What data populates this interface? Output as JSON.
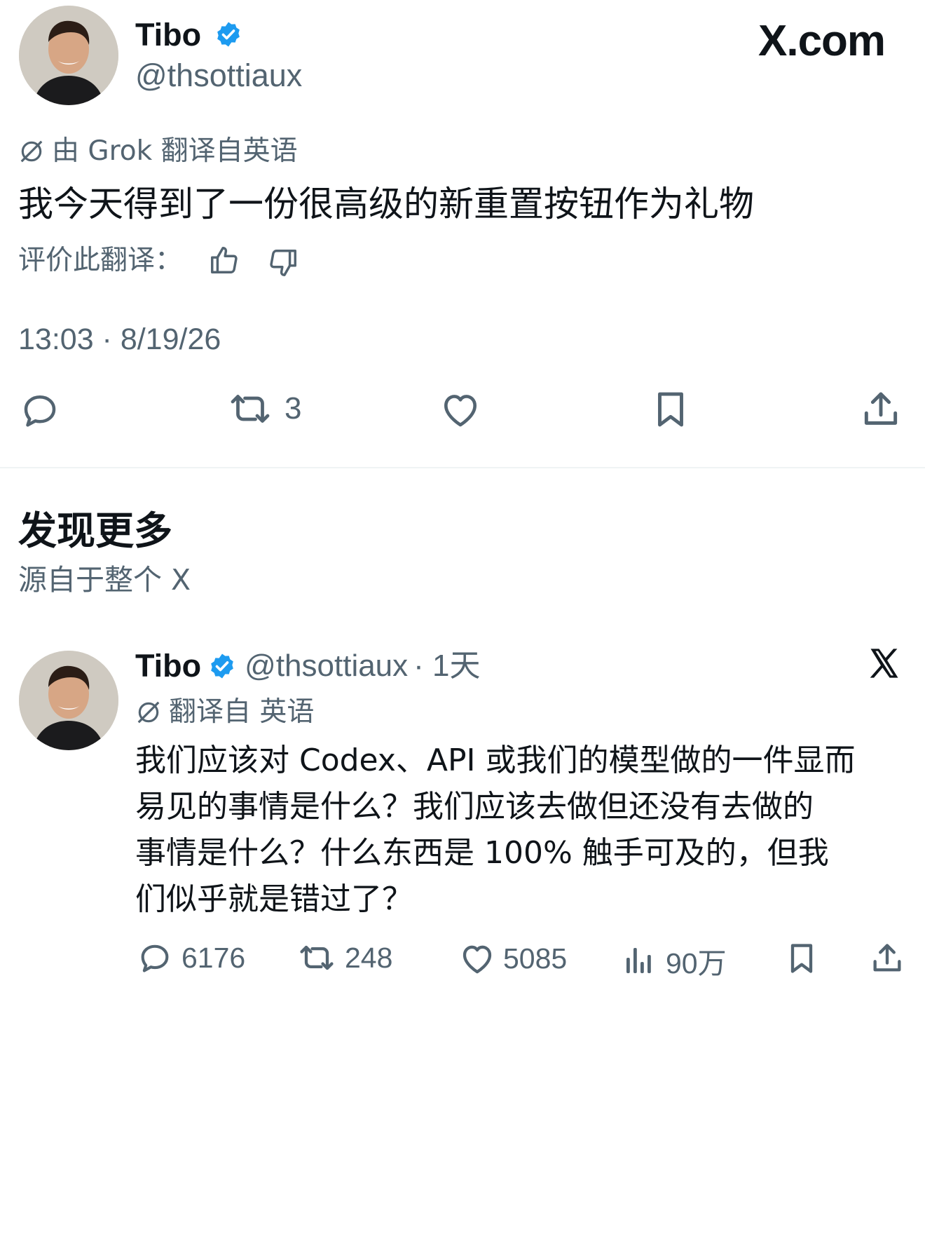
{
  "brand": {
    "logo_text": "X.com"
  },
  "main_tweet": {
    "author_name": "Tibo",
    "author_handle": "@thsottiaux",
    "translated_label": "由 Grok 翻译自英语",
    "text": "我今天得到了一份很高级的新重置按钮作为礼物",
    "rate_label": "评价此翻译：",
    "timestamp": "13:03 · 8/19/26",
    "actions": {
      "reply_icon": "reply-icon",
      "retweet_count": "3",
      "like_icon": "heart-icon",
      "bookmark_icon": "bookmark-icon",
      "share_icon": "share-icon"
    }
  },
  "discover": {
    "title": "发现更多",
    "subtitle": "源自于整个 X"
  },
  "related_tweet": {
    "author_name": "Tibo",
    "author_handle": "@thsottiaux",
    "time": "· 1天",
    "translated_label": "翻译自 英语",
    "text_lines": [
      "我们应该对 Codex、API 或我们的模型做的一件显而",
      "易见的事情是什么？我们应该去做但还没有去做的",
      "事情是什么？什么东西是 100% 触手可及的，但我",
      "们似乎就是错过了？"
    ],
    "reply_count": "6176",
    "retweet_count": "248",
    "like_count": "5085",
    "views_count": "90万"
  },
  "colors": {
    "text": "#0f1419",
    "muted": "#536471",
    "verified": "#1d9bf0",
    "divider": "#eff3f4"
  }
}
